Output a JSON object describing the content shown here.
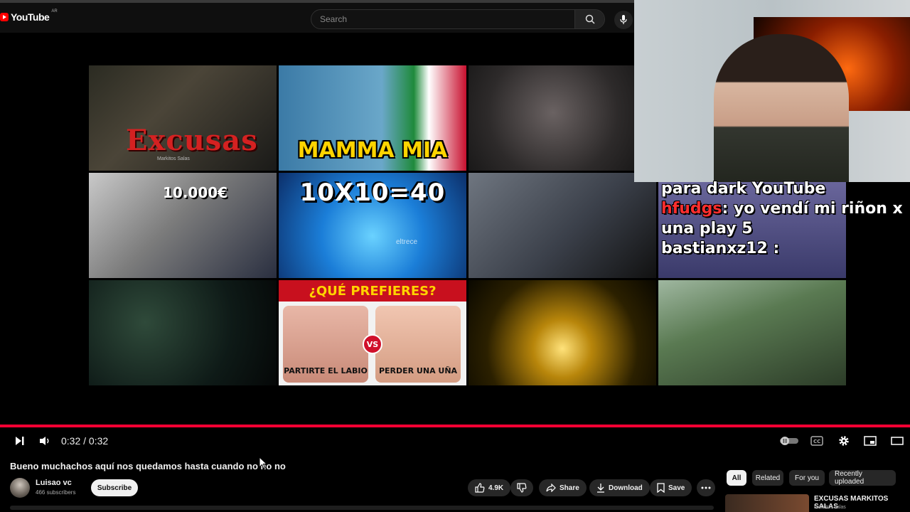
{
  "header": {
    "logo_text": "YouTube",
    "region": "AR",
    "search_placeholder": "Search"
  },
  "grid": {
    "tiles": [
      {
        "overlay_text": "Excusas",
        "overlay_subtext": "Markitos Salas"
      },
      {
        "overlay_text": "MAMMA MIA"
      },
      {
        "overlay_text": ""
      },
      {
        "overlay_text": "10.000€"
      },
      {
        "overlay_text": "10X10=40",
        "watermark": "eltrece"
      },
      {
        "overlay_text": ""
      },
      {
        "overlay_text": ""
      },
      {
        "overlay_text": ""
      },
      {
        "overlay_text": "¿QUÉ PREFIERES?",
        "option_left": "PARTIRTE EL LABIO",
        "vs": "VS",
        "option_right": "PERDER UNA UÑA"
      },
      {
        "overlay_text": ""
      },
      {
        "overlay_text": ""
      }
    ]
  },
  "chat": {
    "line1": "para dark YouTube",
    "line2_user": "hfudgs",
    "line2_msg": ": yo vendí mi riñon x una play 5",
    "line3_user": "bastianxz12",
    "line3_msg": " :"
  },
  "player": {
    "time": "0:32 / 0:32",
    "progress": 1.0,
    "accent": "#ff0033"
  },
  "video": {
    "title": "Bueno muchachos aquí nos quedamos hasta cuando no no no",
    "channel": "Luisao vc",
    "subscribers": "466 subscribers",
    "subscribe_label": "Subscribe",
    "likes": "4.9K",
    "share_label": "Share",
    "download_label": "Download",
    "save_label": "Save"
  },
  "chips": [
    "All",
    "Related",
    "For you",
    "Recently uploaded"
  ],
  "sidebar_video": {
    "title": "EXCUSAS   MARKITOS SALAS",
    "channel": "markitos salas"
  },
  "icons": [
    "youtube-play-icon",
    "search-icon",
    "mic-icon",
    "play-pause-icon",
    "volume-icon",
    "autoplay-toggle-icon",
    "captions-icon",
    "settings-icon",
    "miniplayer-icon",
    "theater-icon",
    "like-icon",
    "dislike-icon",
    "share-icon",
    "download-icon",
    "save-icon",
    "more-icon"
  ]
}
